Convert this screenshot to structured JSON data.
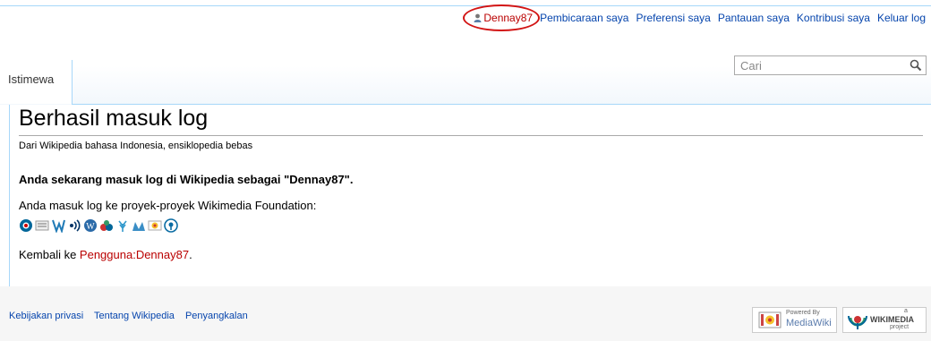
{
  "personal_tools": {
    "username": "Dennay87",
    "talk": "Pembicaraan saya",
    "preferences": "Preferensi saya",
    "watchlist": "Pantauan saya",
    "contributions": "Kontribusi saya",
    "logout": "Keluar log"
  },
  "tabs": {
    "special": "Istimewa"
  },
  "search": {
    "placeholder": "Cari"
  },
  "content": {
    "title": "Berhasil masuk log",
    "tagline": "Dari Wikipedia bahasa Indonesia, ensiklopedia bebas",
    "success_message": "Anda sekarang masuk log di Wikipedia sebagai \"Dennay87\".",
    "projects_text": "Anda masuk log ke proyek-proyek Wikimedia Foundation:",
    "project_icons": [
      "commons-icon",
      "wikibooks-icon",
      "wikiversity-icon",
      "wikisource-icon",
      "wikipedia-icon",
      "meta-icon",
      "wikispecies-icon",
      "wikinews-icon",
      "mediawiki-icon",
      "wikiquote-icon"
    ],
    "return_prefix": "Kembali ke ",
    "return_link": "Pengguna:Dennay87",
    "return_suffix": "."
  },
  "footer": {
    "links": [
      "Kebijakan privasi",
      "Tentang Wikipedia",
      "Penyangkalan"
    ],
    "badge_mediawiki_small": "Powered By",
    "badge_mediawiki": "MediaWiki",
    "badge_wikimedia_small": "a",
    "badge_wikimedia": "WIKIMEDIA",
    "badge_wikimedia_sub": "project"
  },
  "colors": {
    "link": "#0645ad",
    "user_link": "#ba0000",
    "highlight_circle": "#d21414",
    "border": "#a7d7f9"
  }
}
